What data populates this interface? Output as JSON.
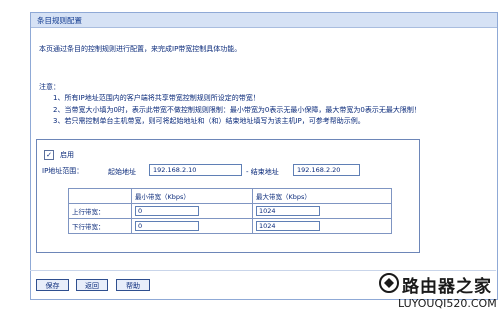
{
  "window": {
    "title": "条目规则配置"
  },
  "description": "本页通过条目的控制规则进行配置，来完成IP带宽控制具体功能。",
  "notes": {
    "label": "注意：",
    "items": [
      "1、所有IP地址范围内的客户端将共享带宽控制规则所设定的带宽！",
      "2、当带宽大小填为0时，表示此带宽不做控制规则限制：最小带宽为0表示无最小保障，最大带宽为0表示无最大限制！",
      "3、若只需控制单台主机带宽，则可将起始地址和（和）结束地址填写为该主机IP，可参考帮助示例。"
    ]
  },
  "form": {
    "enable_checked": true,
    "enable_label": "启用",
    "ip_range_label": "IP地址范围：",
    "start_label": "起始地址",
    "start_value": "192.168.2.10",
    "end_label": "- 结束地址",
    "end_value": "192.168.2.20"
  },
  "bandwidth_table": {
    "headers": [
      "",
      "最小带宽（Kbps）",
      "最大带宽（Kbps）"
    ],
    "rows": [
      {
        "label": "上行带宽：",
        "min": "0",
        "max": "1024"
      },
      {
        "label": "下行带宽：",
        "min": "0",
        "max": "1024"
      }
    ]
  },
  "buttons": {
    "save": "保存",
    "back": "返回",
    "help": "帮助"
  },
  "watermark": {
    "text": "路由器之家",
    "url": "LUYOUQI520.COM"
  }
}
